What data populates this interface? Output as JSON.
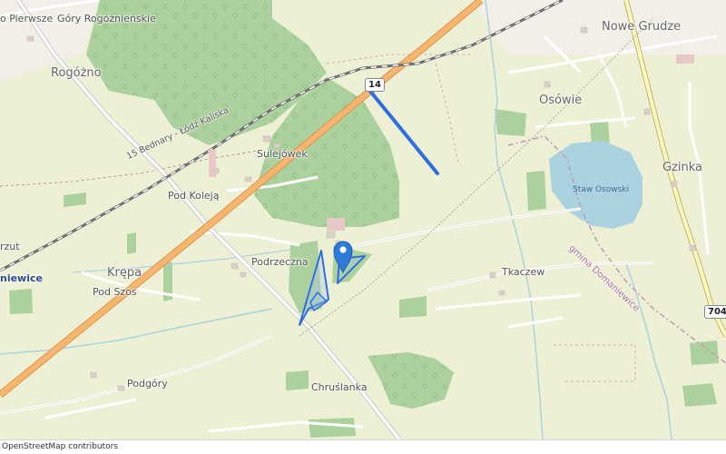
{
  "map": {
    "places": [
      {
        "key": "pierwsze",
        "text": "o Pierwsze"
      },
      {
        "key": "gory",
        "text": "Góry Rogóżnieńskie"
      },
      {
        "key": "rogozno",
        "text": "Rogóżno"
      },
      {
        "key": "nowe_grudze",
        "text": "Nowe Grudze"
      },
      {
        "key": "osowie",
        "text": "Osówie"
      },
      {
        "key": "sulejowek",
        "text": "Sulejówek"
      },
      {
        "key": "gzinka",
        "text": "Gzinka"
      },
      {
        "key": "pod_koleja",
        "text": "Pod Koleją"
      },
      {
        "key": "krepa",
        "text": "Krępa"
      },
      {
        "key": "pod_szos",
        "text": "Pod Szos"
      },
      {
        "key": "podrzeczna",
        "text": "Podrzeczna"
      },
      {
        "key": "tkaczew",
        "text": "Tkaczew"
      },
      {
        "key": "podgory",
        "text": "Podgóry"
      },
      {
        "key": "chruslanka",
        "text": "Chruślanka"
      },
      {
        "key": "rzut",
        "text": "rzut"
      },
      {
        "key": "niewice",
        "text": "niewice"
      }
    ],
    "lake_name": "Staw Osowski",
    "road_name": "15 Bednary - Łódź Kaliska",
    "boundary_name": "gmina Domaniewice",
    "shields": {
      "road14": "14",
      "road704": "704"
    },
    "attribution": "OpenStreetMap contributors"
  },
  "colors": {
    "background": "#f2efe9",
    "farmland": "#eef0d5",
    "forest": "#add19e",
    "water": "#aad3df",
    "primary_road": "#f8b56e",
    "secondary_road": "#f7fabf",
    "railway": "#707070",
    "boundary": "#c09ab8",
    "highlight": "#2e6fe0",
    "marker": "#2e7bd9"
  }
}
